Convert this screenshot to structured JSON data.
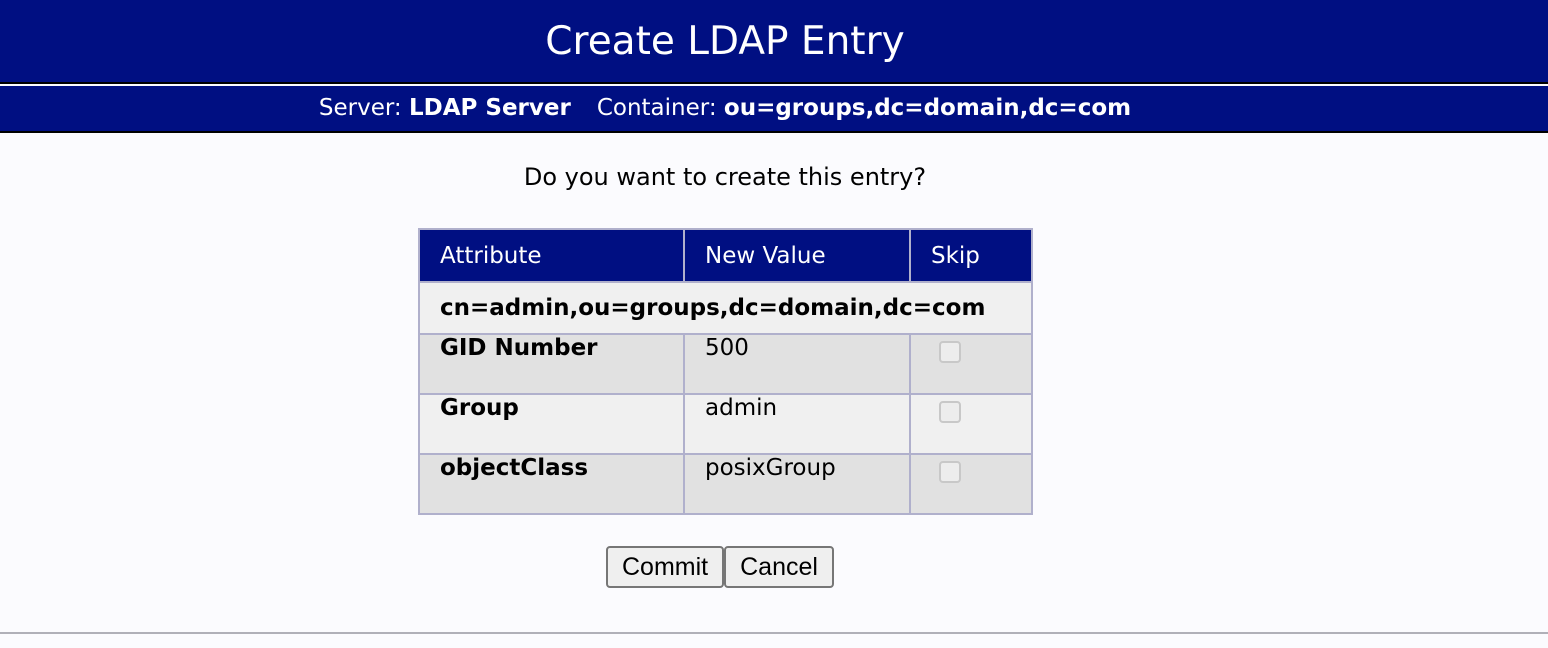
{
  "header": {
    "title": "Create LDAP Entry",
    "server_label": "Server:",
    "server_name": "LDAP Server",
    "container_label": "Container:",
    "container_dn": "ou=groups,dc=domain,dc=com"
  },
  "main": {
    "question": "Do you want to create this entry?",
    "table": {
      "headers": [
        "Attribute",
        "New Value",
        "Skip"
      ],
      "dn": "cn=admin,ou=groups,dc=domain,dc=com",
      "rows": [
        {
          "attribute": "GID Number",
          "value": "500",
          "skip": false
        },
        {
          "attribute": "Group",
          "value": "admin",
          "skip": false
        },
        {
          "attribute": "objectClass",
          "value": "posixGroup",
          "skip": false
        }
      ]
    },
    "buttons": {
      "commit": "Commit",
      "cancel": "Cancel"
    }
  },
  "colors": {
    "header_bg": "#000f82",
    "row_dark": "#e1e1e1",
    "row_light": "#f0f0f0"
  }
}
